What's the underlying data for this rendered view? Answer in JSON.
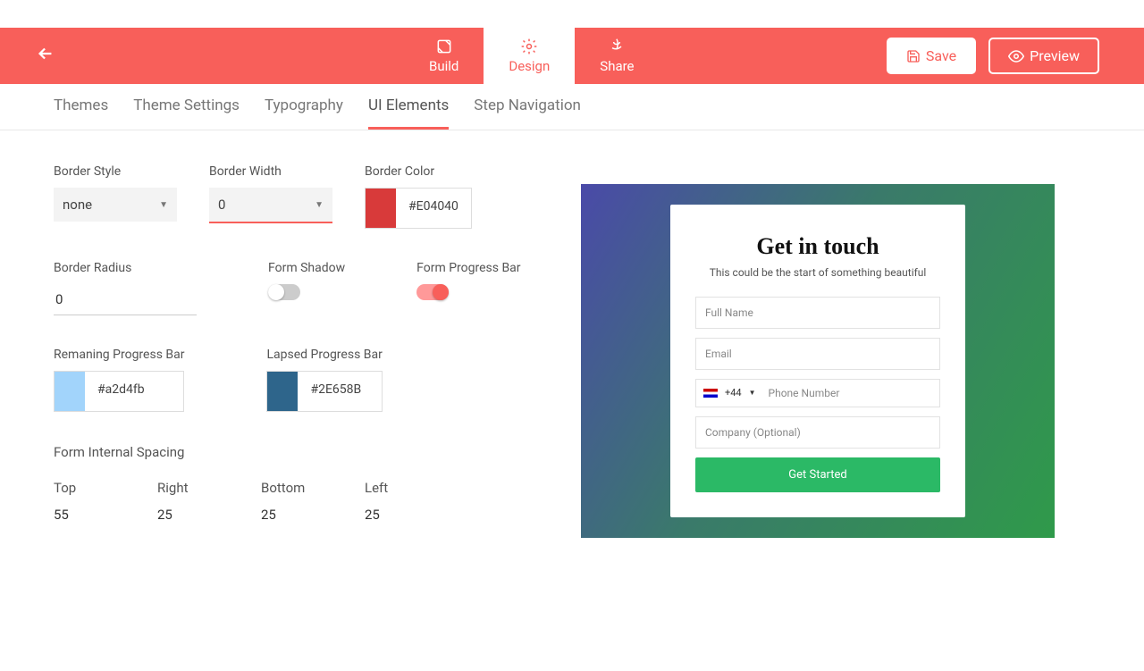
{
  "topnav": {
    "build": "Build",
    "design": "Design",
    "share": "Share",
    "save": "Save",
    "preview": "Preview"
  },
  "subnav": {
    "themes": "Themes",
    "theme_settings": "Theme Settings",
    "typography": "Typography",
    "ui_elements": "UI Elements",
    "step_nav": "Step Navigation"
  },
  "settings": {
    "border_style_label": "Border Style",
    "border_style_value": "none",
    "border_width_label": "Border Width",
    "border_width_value": "0",
    "border_color_label": "Border Color",
    "border_color_value": "#E04040",
    "border_color_swatch": "#d83a3a",
    "border_radius_label": "Border Radius",
    "border_radius_value": "0",
    "form_shadow_label": "Form Shadow",
    "form_shadow_on": false,
    "progress_bar_label": "Form Progress Bar",
    "progress_bar_on": true,
    "remaining_label": "Remaning Progress Bar",
    "remaining_value": "#a2d4fb",
    "remaining_swatch": "#a2d4fb",
    "lapsed_label": "Lapsed Progress Bar",
    "lapsed_value": "#2E658B",
    "lapsed_swatch": "#2E658B",
    "spacing_label": "Form Internal Spacing",
    "spacing": {
      "top_label": "Top",
      "top": "55",
      "right_label": "Right",
      "right": "25",
      "bottom_label": "Bottom",
      "bottom": "25",
      "left_label": "Left",
      "left": "25"
    }
  },
  "form_preview": {
    "title": "Get in touch",
    "subtitle": "This could be the start of something beautiful",
    "full_name": "Full Name",
    "email": "Email",
    "country_code": "+44",
    "phone": "Phone Number",
    "company": "Company (Optional)",
    "cta": "Get Started"
  }
}
